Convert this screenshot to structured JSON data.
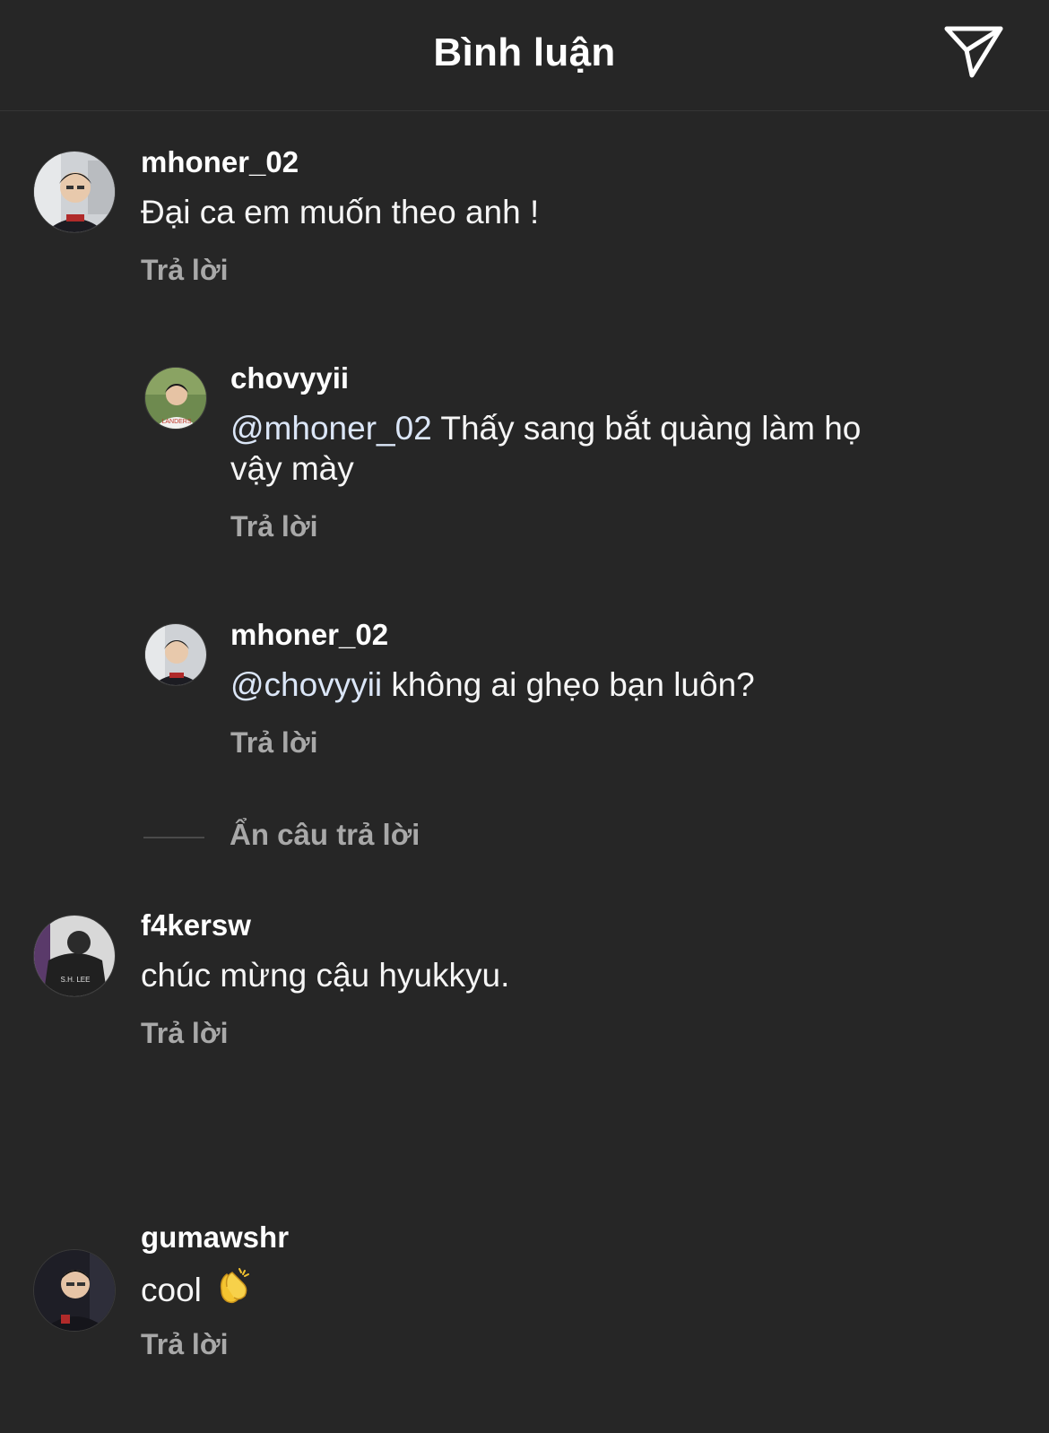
{
  "header": {
    "title": "Bình luận",
    "share_icon": "paper-plane-icon"
  },
  "comments": [
    {
      "username": "mhoner_02",
      "text": "Đại ca em muốn theo anh !",
      "reply_label": "Trả lời"
    },
    {
      "username": "chovyyii",
      "mention": "@mhoner_02",
      "text": " Thấy sang bắt quàng làm họ vậy mày",
      "reply_label": "Trả lời"
    },
    {
      "username": "mhoner_02",
      "mention": "@chovyyii",
      "text": " không ai ghẹo bạn luôn?",
      "reply_label": "Trả lời"
    },
    {
      "username": "f4kersw",
      "text": "chúc mừng cậu hyukkyu.",
      "reply_label": "Trả lời"
    },
    {
      "username": "gumawshr",
      "text": "cool",
      "emoji": "clapping-hands-icon",
      "reply_label": "Trả lời"
    }
  ],
  "hide_replies_label": "Ẩn câu trả lời",
  "colors": {
    "background": "#262626",
    "muted_text": "#a8a8a8",
    "mention": "#dbe6f7"
  }
}
